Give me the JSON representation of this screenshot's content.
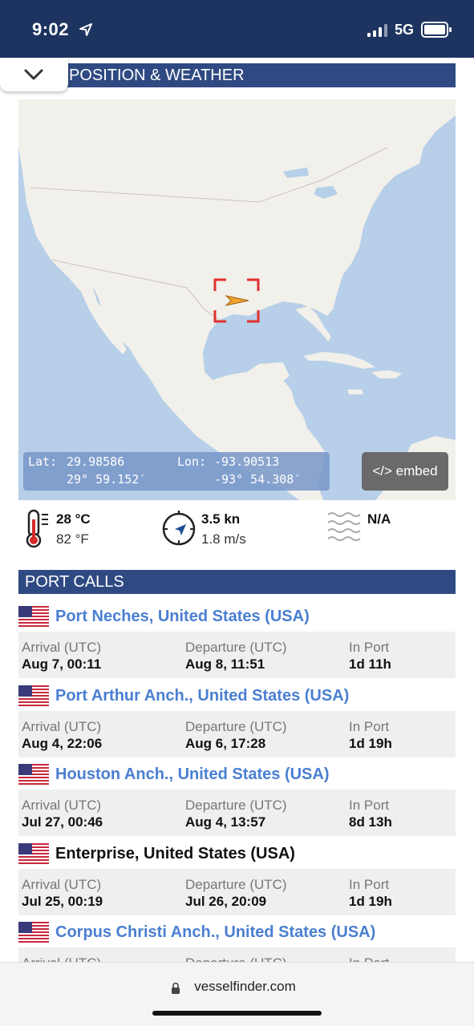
{
  "status": {
    "time": "9:02",
    "network": "5G"
  },
  "sections": {
    "position_title": "POSITION & WEATHER",
    "port_calls_title": "PORT CALLS"
  },
  "map": {
    "lat_label": "Lat:",
    "lat_decimal": "29.98586",
    "lat_dms": "29° 59.152′",
    "lon_label": "Lon:",
    "lon_decimal": "-93.90513",
    "lon_dms": "-93° 54.308′",
    "embed_label": "</> embed",
    "marker_color": "#f0a030",
    "target_color": "#e03030"
  },
  "weather": {
    "temp_c": "28 °C",
    "temp_f": "82 °F",
    "speed_kn": "3.5 kn",
    "speed_ms": "1.8 m/s",
    "wave": "N/A"
  },
  "columns": {
    "arrival": "Arrival (UTC)",
    "departure": "Departure (UTC)",
    "in_port": "In Port"
  },
  "port_calls": [
    {
      "name": "Port Neches, United States (USA)",
      "arrival": "Aug 7, 00:11",
      "departure": "Aug 8, 11:51",
      "in_port": "1d 11h",
      "link": true
    },
    {
      "name": "Port Arthur Anch., United States (USA)",
      "arrival": "Aug 4, 22:06",
      "departure": "Aug 6, 17:28",
      "in_port": "1d 19h",
      "link": true
    },
    {
      "name": "Houston Anch., United States (USA)",
      "arrival": "Jul 27, 00:46",
      "departure": "Aug 4, 13:57",
      "in_port": "8d 13h",
      "link": true
    },
    {
      "name": "Enterprise, United States (USA)",
      "arrival": "Jul 25, 00:19",
      "departure": "Jul 26, 20:09",
      "in_port": "1d 19h",
      "link": false
    },
    {
      "name": "Corpus Christi Anch., United States (USA)",
      "arrival": "",
      "departure": "",
      "in_port": "",
      "link": true
    }
  ],
  "browser": {
    "url": "vesselfinder.com"
  },
  "colors": {
    "header_bg": "#2f4a82",
    "status_bg": "#1d3461",
    "link": "#4a7fd1"
  }
}
